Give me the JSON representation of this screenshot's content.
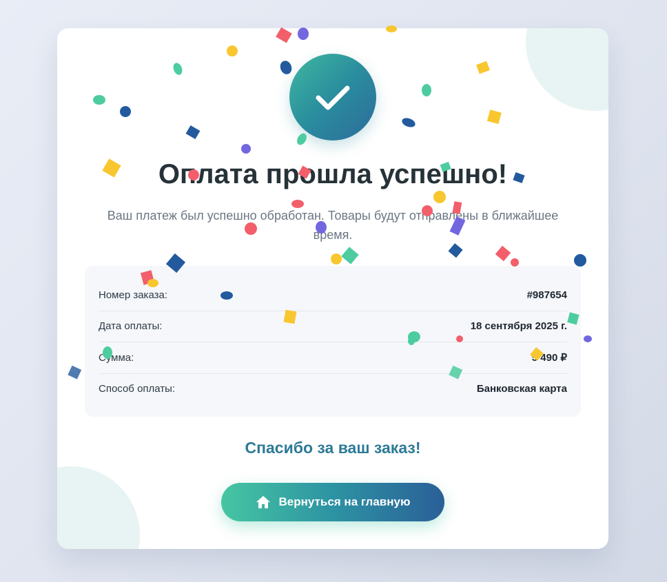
{
  "success": {
    "icon": "checkmark-icon",
    "title": "Оплата прошла успешно!",
    "message": "Ваш платеж был успешно обработан. Товары будут отправлены в ближайшее время."
  },
  "order": {
    "rows": [
      {
        "label": "Номер заказа:",
        "value": "#987654"
      },
      {
        "label": "Дата оплаты:",
        "value": "18 сентября 2025 г."
      },
      {
        "label": "Сумма:",
        "value": "5 490 ₽"
      },
      {
        "label": "Способ оплаты:",
        "value": "Банковская карта"
      }
    ]
  },
  "thanks": "Спасибо за ваш заказ!",
  "home_button": {
    "icon": "home-icon",
    "label": "Вернуться на главную"
  },
  "colors": {
    "accent_start": "#46c6a2",
    "accent_end": "#2a5f98",
    "confetti": [
      "#f25f6b",
      "#f8c62f",
      "#4dcc9f",
      "#235a9e",
      "#7367e0"
    ]
  }
}
